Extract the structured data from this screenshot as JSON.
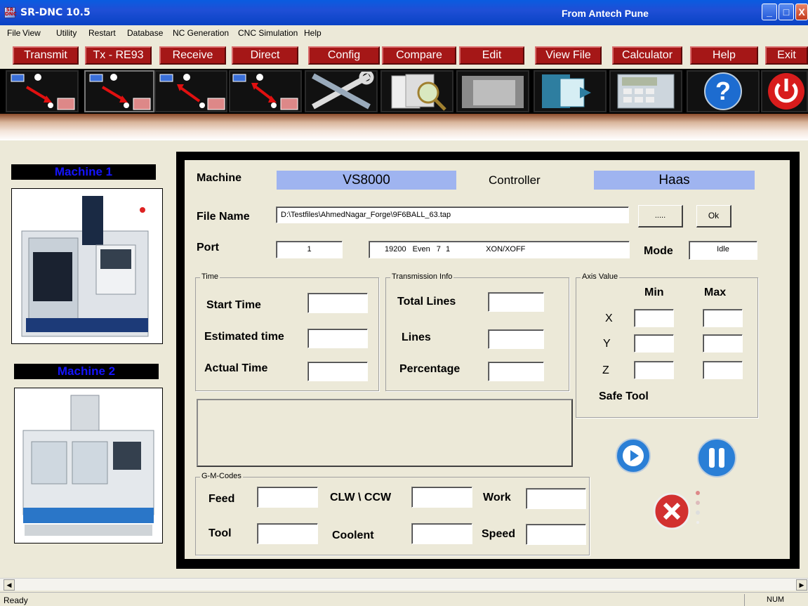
{
  "titlebar": {
    "app_title": "SR-DNC  10.5",
    "center_text": "From Antech Pune",
    "icon_text": "SR DNC"
  },
  "window_controls": {
    "minimize": "_",
    "maximize": "□",
    "close": "X"
  },
  "menu": [
    "File",
    "View",
    "Utility",
    "Restart",
    "Database",
    "NC Generation",
    "CNC Simulation",
    "Help"
  ],
  "commands": [
    "Transmit",
    "Tx - RE93",
    "Receive",
    "Direct",
    "Config",
    "Compare",
    "Edit",
    "View File",
    "Calculator",
    "Help",
    "Exit"
  ],
  "toolbar_icons": [
    "transmit-icon",
    "tx-re93-icon",
    "receive-icon",
    "direct-icon",
    "config-tools-icon",
    "compare-icon",
    "edit-icon",
    "view-file-icon",
    "calculator-icon",
    "help-icon",
    "exit-power-icon"
  ],
  "machines": [
    {
      "label": "Machine 1"
    },
    {
      "label": "Machine 2"
    }
  ],
  "main": {
    "machine_label": "Machine",
    "machine_value": "VS8000",
    "controller_label": "Controller",
    "controller_value": "Haas",
    "file_name_label": "File Name",
    "file_name_value": "D:\\Testfiles\\AhmedNagar_Forge\\9F6BALL_63.tap",
    "browse_button": ".....",
    "ok_button": "Ok",
    "port_label": "Port",
    "port_value": "1",
    "comm_settings": {
      "baud": "19200",
      "parity": "Even",
      "data_bits": "7",
      "stop_bits": "1",
      "flow": "XON/XOFF"
    },
    "mode_label": "Mode",
    "mode_value": "Idle",
    "time_group": {
      "title": "Time",
      "start": "Start Time",
      "estimated": "Estimated time",
      "actual": "Actual Time"
    },
    "transmission_group": {
      "title": "Transmission Info",
      "total_lines": "Total Lines",
      "lines": "Lines",
      "percentage": "Percentage"
    },
    "axis_group": {
      "title": "Axis Value",
      "min": "Min",
      "max": "Max",
      "x": "X",
      "y": "Y",
      "z": "Z",
      "safe_tool": "Safe Tool"
    },
    "gm_group": {
      "title": "G-M-Codes",
      "feed": "Feed",
      "clw": "CLW \\ CCW",
      "work": "Work",
      "tool": "Tool",
      "coolent": "Coolent",
      "speed": "Speed"
    }
  },
  "actions": [
    "play-icon",
    "pause-icon",
    "stop-cancel-icon"
  ],
  "status": {
    "text": "Ready",
    "num": "NUM"
  },
  "colors": {
    "command_button": "#a51717",
    "value_highlight": "#9fb4f0",
    "machine_label_text": "#1414ff",
    "titlebar": "#0a5ce0"
  }
}
